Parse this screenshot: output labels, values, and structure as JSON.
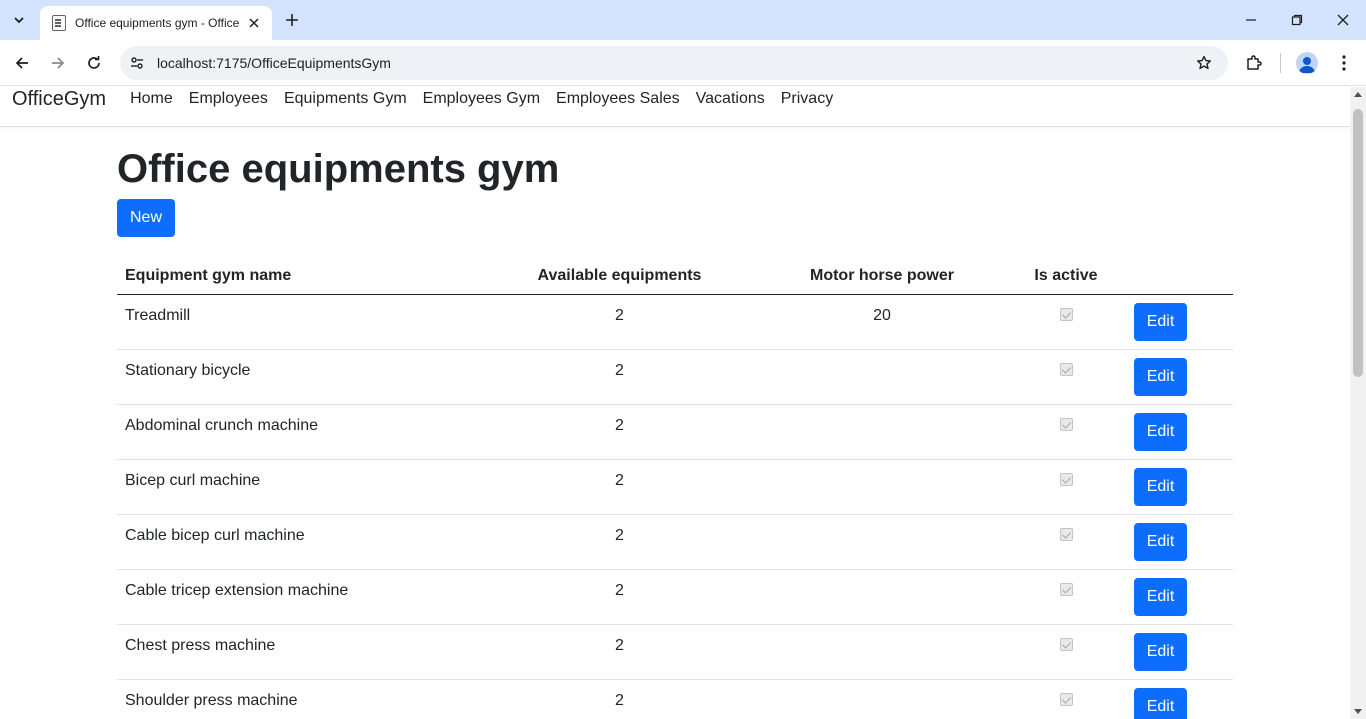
{
  "browser": {
    "tab_title": "Office equipments gym - OfficeGym",
    "url": "localhost:7175/OfficeEquipmentsGym"
  },
  "navbar": {
    "brand": "OfficeGym",
    "links": [
      "Home",
      "Employees",
      "Equipments Gym",
      "Employees Gym",
      "Employees Sales",
      "Vacations",
      "Privacy"
    ]
  },
  "page": {
    "title": "Office equipments gym",
    "new_label": "New"
  },
  "table": {
    "headers": [
      "Equipment gym name",
      "Available equipments",
      "Motor horse power",
      "Is active"
    ],
    "edit_label": "Edit",
    "rows": [
      {
        "name": "Treadmill",
        "available": "2",
        "motor": "20",
        "active": true
      },
      {
        "name": "Stationary bicycle",
        "available": "2",
        "motor": "",
        "active": true
      },
      {
        "name": "Abdominal crunch machine",
        "available": "2",
        "motor": "",
        "active": true
      },
      {
        "name": "Bicep curl machine",
        "available": "2",
        "motor": "",
        "active": true
      },
      {
        "name": "Cable bicep curl machine",
        "available": "2",
        "motor": "",
        "active": true
      },
      {
        "name": "Cable tricep extension machine",
        "available": "2",
        "motor": "",
        "active": true
      },
      {
        "name": "Chest press machine",
        "available": "2",
        "motor": "",
        "active": true
      },
      {
        "name": "Shoulder press machine",
        "available": "2",
        "motor": "",
        "active": true
      }
    ]
  },
  "colors": {
    "primary": "#0d6efd",
    "tabstrip": "#d3e3fd"
  }
}
